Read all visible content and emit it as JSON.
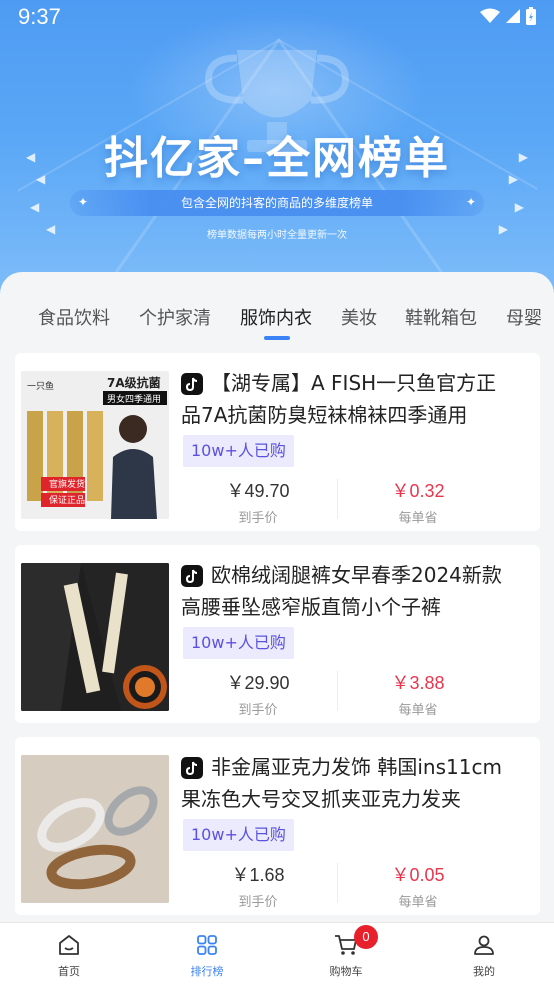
{
  "status_bar": {
    "time": "9:37"
  },
  "banner": {
    "title": "抖亿家–全网榜单",
    "subtitle": "包含全网的抖客的商品的多维度榜单",
    "note": "榜单数据每两小时全量更新一次"
  },
  "tabs": [
    {
      "label": "食品饮料",
      "active": false
    },
    {
      "label": "个护家清",
      "active": false
    },
    {
      "label": "服饰内衣",
      "active": true
    },
    {
      "label": "美妆",
      "active": false
    },
    {
      "label": "鞋靴箱包",
      "active": false
    },
    {
      "label": "母婴",
      "active": false
    }
  ],
  "products": [
    {
      "title": "【湖专属】A FISH一只鱼官方正品7A抗菌防臭短袜棉袜四季通用",
      "sales": "10w+人已购",
      "final_price": "￥49.70",
      "final_label": "到手价",
      "save_price": "￥0.32",
      "save_label": "每单省",
      "thumb_text_top": "7A级抗菌",
      "thumb_text_sub": "男女四季通用",
      "thumb_badge_1": "官旗发货",
      "thumb_badge_2": "保证正品",
      "thumb_logo": "一只鱼"
    },
    {
      "title": "欧棉绒阔腿裤女早春季2024新款高腰垂坠感窄版直筒小个子裤",
      "sales": "10w+人已购",
      "final_price": "￥29.90",
      "final_label": "到手价",
      "save_price": "￥3.88",
      "save_label": "每单省"
    },
    {
      "title": "非金属亚克力发饰 韩国ins11cm果冻色大号交叉抓夹亚克力发夹",
      "sales": "10w+人已购",
      "final_price": "￥1.68",
      "final_label": "到手价",
      "save_price": "￥0.05",
      "save_label": "每单省"
    }
  ],
  "bottom_nav": [
    {
      "label": "首页",
      "icon": "home-icon",
      "active": false
    },
    {
      "label": "排行榜",
      "icon": "grid-icon",
      "active": true
    },
    {
      "label": "购物车",
      "icon": "cart-icon",
      "active": false,
      "badge": "0"
    },
    {
      "label": "我的",
      "icon": "user-icon",
      "active": false
    }
  ],
  "colors": {
    "accent": "#3b82f6",
    "price_save": "#e8364d",
    "sales_text": "#5a52e0",
    "badge_red": "#e8202c"
  }
}
